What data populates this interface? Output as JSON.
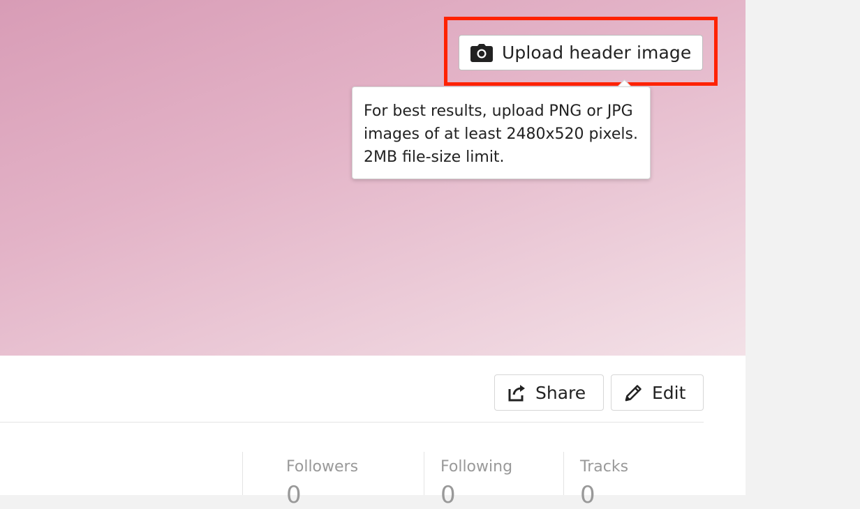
{
  "header": {
    "upload_button_label": "Upload header image",
    "upload_button_icon": "camera-icon",
    "tooltip_text": "For best results, upload PNG or JPG images of at least 2480x520 pixels. 2MB file-size limit.",
    "gradient_colors": [
      "#d89cb6",
      "#e3b3c7",
      "#f3e1e7"
    ],
    "highlight_color": "#ff2200"
  },
  "actions": {
    "share_label": "Share",
    "share_icon": "share-icon",
    "edit_label": "Edit",
    "edit_icon": "pencil-icon"
  },
  "stats": [
    {
      "label": "Followers",
      "value": "0"
    },
    {
      "label": "Following",
      "value": "0"
    },
    {
      "label": "Tracks",
      "value": "0"
    }
  ]
}
